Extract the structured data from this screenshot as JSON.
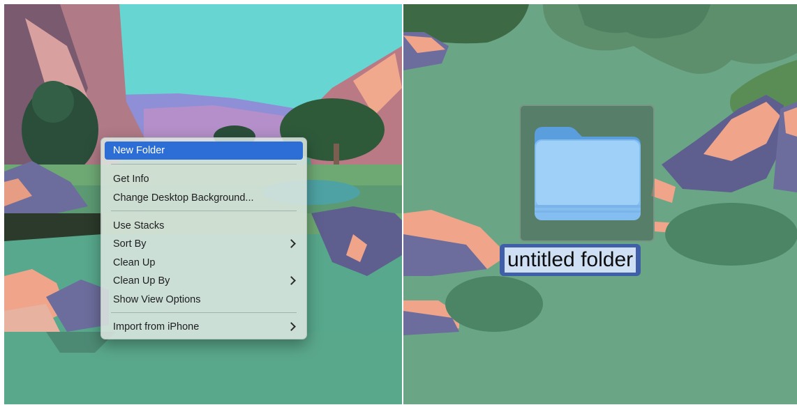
{
  "context_menu": {
    "items": [
      {
        "label": "New Folder",
        "highlighted": true,
        "has_submenu": false
      },
      {
        "label": "Get Info",
        "has_submenu": false
      },
      {
        "label": "Change Desktop Background...",
        "has_submenu": false
      },
      {
        "label": "Use Stacks",
        "has_submenu": false
      },
      {
        "label": "Sort By",
        "has_submenu": true
      },
      {
        "label": "Clean Up",
        "has_submenu": false
      },
      {
        "label": "Clean Up By",
        "has_submenu": true
      },
      {
        "label": "Show View Options",
        "has_submenu": false
      },
      {
        "label": "Import from iPhone",
        "has_submenu": true
      }
    ]
  },
  "desktop_folder": {
    "name": "untitled folder",
    "icon": "folder-icon",
    "selected": true,
    "name_editing": true
  },
  "colors": {
    "menu_highlight": "#2c6ed5",
    "name_field_border": "#3f5fa8",
    "name_selection": "#cfe0f5",
    "folder_blue": "#8ec3f2"
  }
}
